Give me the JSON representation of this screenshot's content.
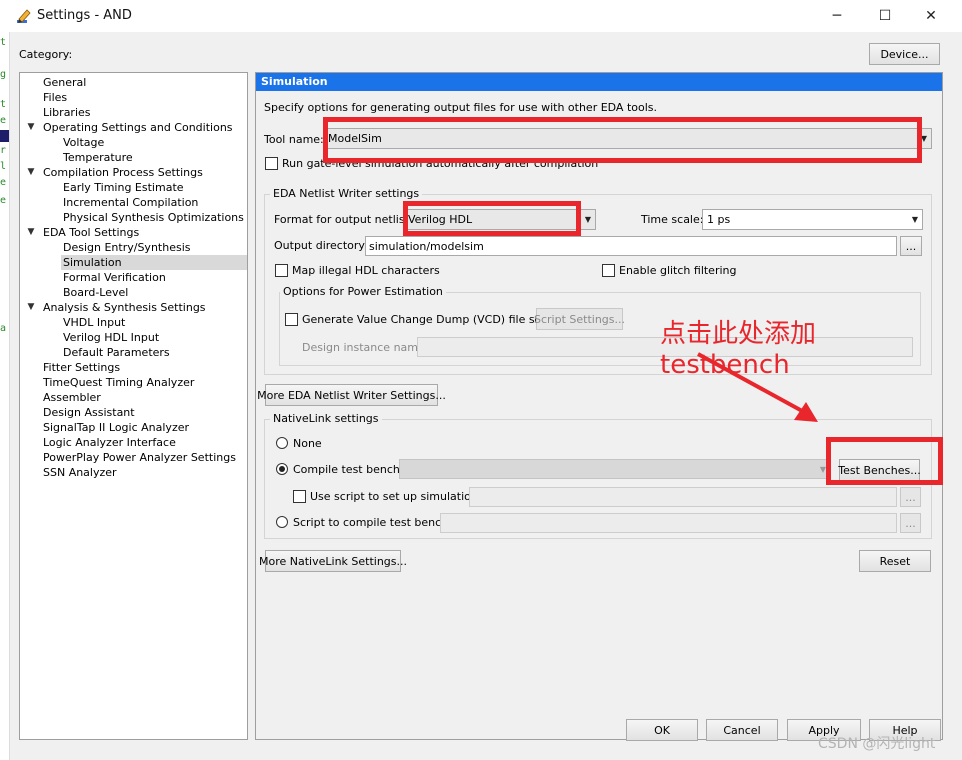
{
  "window": {
    "title": "Settings - AND",
    "controls": {
      "minimize": "─",
      "maximize": "☐",
      "close": "✕"
    }
  },
  "category": {
    "label": "Category:",
    "device_button": "Device...",
    "items": [
      {
        "label": "General"
      },
      {
        "label": "Files"
      },
      {
        "label": "Libraries"
      },
      {
        "label": "Operating Settings and Conditions"
      },
      {
        "label": "Voltage"
      },
      {
        "label": "Temperature"
      },
      {
        "label": "Compilation Process Settings"
      },
      {
        "label": "Early Timing Estimate"
      },
      {
        "label": "Incremental Compilation"
      },
      {
        "label": "Physical Synthesis Optimizations"
      },
      {
        "label": "EDA Tool Settings"
      },
      {
        "label": "Design Entry/Synthesis"
      },
      {
        "label": "Simulation"
      },
      {
        "label": "Formal Verification"
      },
      {
        "label": "Board-Level"
      },
      {
        "label": "Analysis & Synthesis Settings"
      },
      {
        "label": "VHDL Input"
      },
      {
        "label": "Verilog HDL Input"
      },
      {
        "label": "Default Parameters"
      },
      {
        "label": "Fitter Settings"
      },
      {
        "label": "TimeQuest Timing Analyzer"
      },
      {
        "label": "Assembler"
      },
      {
        "label": "Design Assistant"
      },
      {
        "label": "SignalTap II Logic Analyzer"
      },
      {
        "label": "Logic Analyzer Interface"
      },
      {
        "label": "PowerPlay Power Analyzer Settings"
      },
      {
        "label": "SSN Analyzer"
      }
    ]
  },
  "simulation": {
    "header": "Simulation",
    "description": "Specify options for generating output files for use with other EDA tools.",
    "tool_name_label": "Tool name:",
    "tool_name_value": "ModelSim",
    "run_gate_level": "Run gate-level simulation automatically after compilation",
    "netlist": {
      "title": "EDA Netlist Writer settings",
      "format_label": "Format for output netlist:",
      "format_value": "Verilog HDL",
      "timescale_label": "Time scale:",
      "timescale_value": "1 ps",
      "output_dir_label": "Output directory:",
      "output_dir_value": "simulation/modelsim",
      "browse": "...",
      "map_illegal": "Map illegal HDL characters",
      "glitch": "Enable glitch filtering",
      "power": {
        "title": "Options for Power Estimation",
        "vcd": "Generate Value Change Dump (VCD) file script",
        "script_settings": "Script Settings...",
        "instance_label": "Design instance name:"
      }
    },
    "more_netlist_button": "More EDA Netlist Writer Settings...",
    "nativelink": {
      "title": "NativeLink settings",
      "none": "None",
      "compile_tb": "Compile test bench:",
      "test_benches_button": "Test Benches...",
      "use_script": "Use script to set up simulation:",
      "script_compile": "Script to compile test bench:",
      "browse": "..."
    },
    "more_nativelink_button": "More NativeLink Settings...",
    "reset_button": "Reset"
  },
  "footer": {
    "ok": "OK",
    "cancel": "Cancel",
    "apply": "Apply",
    "help": "Help"
  },
  "annotation": {
    "line1": "点击此处添加",
    "line2": "testbench"
  },
  "watermark": "CSDN @闪光light",
  "gutter_chars": [
    "t",
    "g",
    "t",
    "e",
    "r",
    "l",
    "e",
    "e",
    "a"
  ],
  "colors": {
    "accent": "#1a73e8",
    "highlight": "#e8262c"
  }
}
